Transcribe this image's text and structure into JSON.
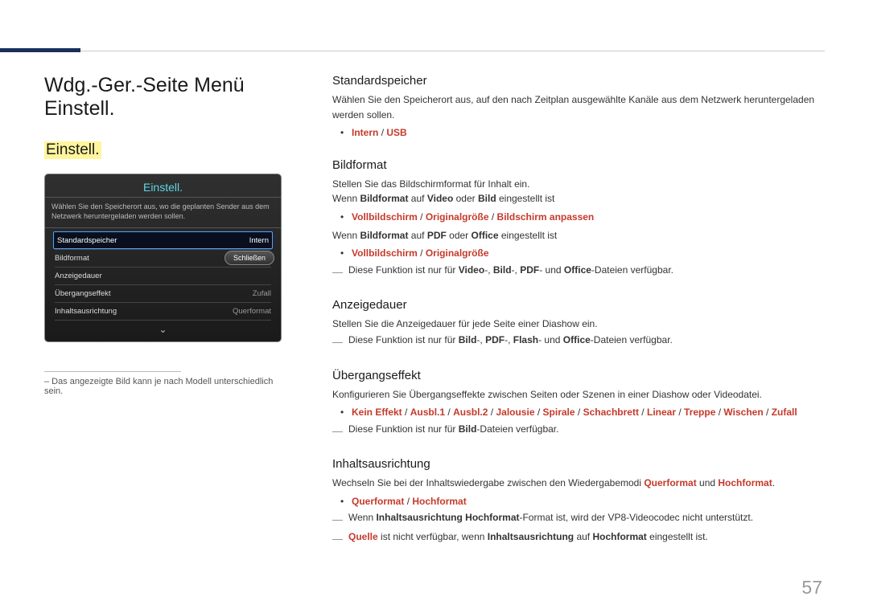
{
  "page": {
    "number": "57",
    "footnote": "– Das angezeigte Bild kann je nach Modell unterschiedlich sein."
  },
  "heading": "Wdg.-Ger.-Seite Menü Einstell.",
  "subheading": "Einstell.",
  "panel": {
    "title": "Einstell.",
    "desc": "Wählen Sie den Speicherort aus, wo die geplanten Sender aus dem Netzwerk heruntergeladen werden sollen.",
    "close": "Schließen",
    "rows": [
      {
        "label": "Standardspeicher",
        "value": "Intern"
      },
      {
        "label": "Bildformat",
        "value": ""
      },
      {
        "label": "Anzeigedauer",
        "value": ""
      },
      {
        "label": "Übergangseffekt",
        "value": "Zufall"
      },
      {
        "label": "Inhaltsausrichtung",
        "value": "Querformat"
      }
    ]
  },
  "sections": {
    "s1": {
      "title": "Standardspeicher",
      "body": "Wählen Sie den Speicherort aus, auf den nach Zeitplan ausgewählte Kanäle aus dem Netzwerk heruntergeladen werden sollen.",
      "opt1": "Intern",
      "opt2": "USB"
    },
    "s2": {
      "title": "Bildformat",
      "body": "Stellen Sie das Bildschirmformat für Inhalt ein.",
      "when1a": "Wenn ",
      "when1b": "Bildformat",
      "when1c": " auf ",
      "when1d": "Video",
      "when1e": " oder ",
      "when1f": "Bild",
      "when1g": " eingestellt ist",
      "o1": "Vollbildschirm",
      "o2": "Originalgröße",
      "o3": "Bildschirm anpassen",
      "when2a": "Wenn ",
      "when2b": "Bildformat",
      "when2c": " auf ",
      "when2d": "PDF",
      "when2e": " oder ",
      "when2f": "Office",
      "when2g": " eingestellt ist",
      "p1": "Vollbildschirm",
      "p2": "Originalgröße",
      "note_a": "Diese Funktion ist nur für ",
      "note_b": "Video",
      "note_c": "-, ",
      "note_d": "Bild",
      "note_e": "-, ",
      "note_f": "PDF",
      "note_g": "- und ",
      "note_h": "Office",
      "note_i": "-Dateien verfügbar."
    },
    "s3": {
      "title": "Anzeigedauer",
      "body": "Stellen Sie die Anzeigedauer für jede Seite einer Diashow ein.",
      "note_a": "Diese Funktion ist nur für ",
      "note_b": "Bild",
      "note_c": "-, ",
      "note_d": "PDF",
      "note_e": "-, ",
      "note_f": "Flash",
      "note_g": "- und ",
      "note_h": "Office",
      "note_i": "-Dateien verfügbar."
    },
    "s4": {
      "title": "Übergangseffekt",
      "body": "Konfigurieren Sie Übergangseffekte zwischen Seiten oder Szenen in einer Diashow oder Videodatei.",
      "o1": "Kein Effekt",
      "o2": "Ausbl.1",
      "o3": "Ausbl.2",
      "o4": "Jalousie",
      "o5": "Spirale",
      "o6": "Schachbrett",
      "o7": "Linear",
      "o8": "Treppe",
      "o9": "Wischen",
      "o10": "Zufall",
      "note_a": "Diese Funktion ist nur für ",
      "note_b": "Bild",
      "note_c": "-Dateien verfügbar."
    },
    "s5": {
      "title": "Inhaltsausrichtung",
      "body_a": "Wechseln Sie bei der Inhaltswiedergabe zwischen den Wiedergabemodi ",
      "body_b": "Querformat",
      "body_c": " und ",
      "body_d": "Hochformat",
      "body_e": ".",
      "o1": "Querformat",
      "o2": "Hochformat",
      "n1a": "Wenn ",
      "n1b": "Inhaltsausrichtung Hochformat",
      "n1c": "-Format ist, wird der VP8-Videocodec nicht unterstützt.",
      "n2a": "Quelle",
      "n2b": " ist nicht verfügbar, wenn ",
      "n2c": "Inhaltsausrichtung",
      "n2d": " auf ",
      "n2e": "Hochformat",
      "n2f": " eingestellt ist."
    }
  }
}
